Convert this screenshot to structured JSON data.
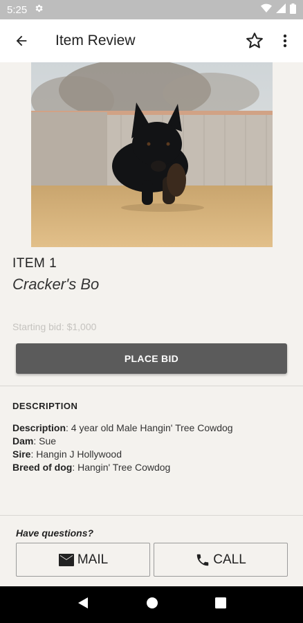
{
  "status_bar": {
    "time": "5:25"
  },
  "app_bar": {
    "title": "Item Review"
  },
  "item": {
    "number": "ITEM 1",
    "name": "Cracker's Bo",
    "starting_bid": "Starting bid: $1,000",
    "place_bid_label": "PLACE BID"
  },
  "description": {
    "heading": "DESCRIPTION",
    "rows": [
      {
        "label": "Description",
        "value": ": 4 year old Male Hangin' Tree Cowdog"
      },
      {
        "label": "Dam",
        "value": ": Sue"
      },
      {
        "label": "Sire",
        "value": ": Hangin J Hollywood"
      },
      {
        "label": "Breed of dog",
        "value": ": Hangin' Tree Cowdog"
      }
    ]
  },
  "contact": {
    "prompt": "Have questions?",
    "mail_label": "MAIL",
    "call_label": "CALL"
  }
}
